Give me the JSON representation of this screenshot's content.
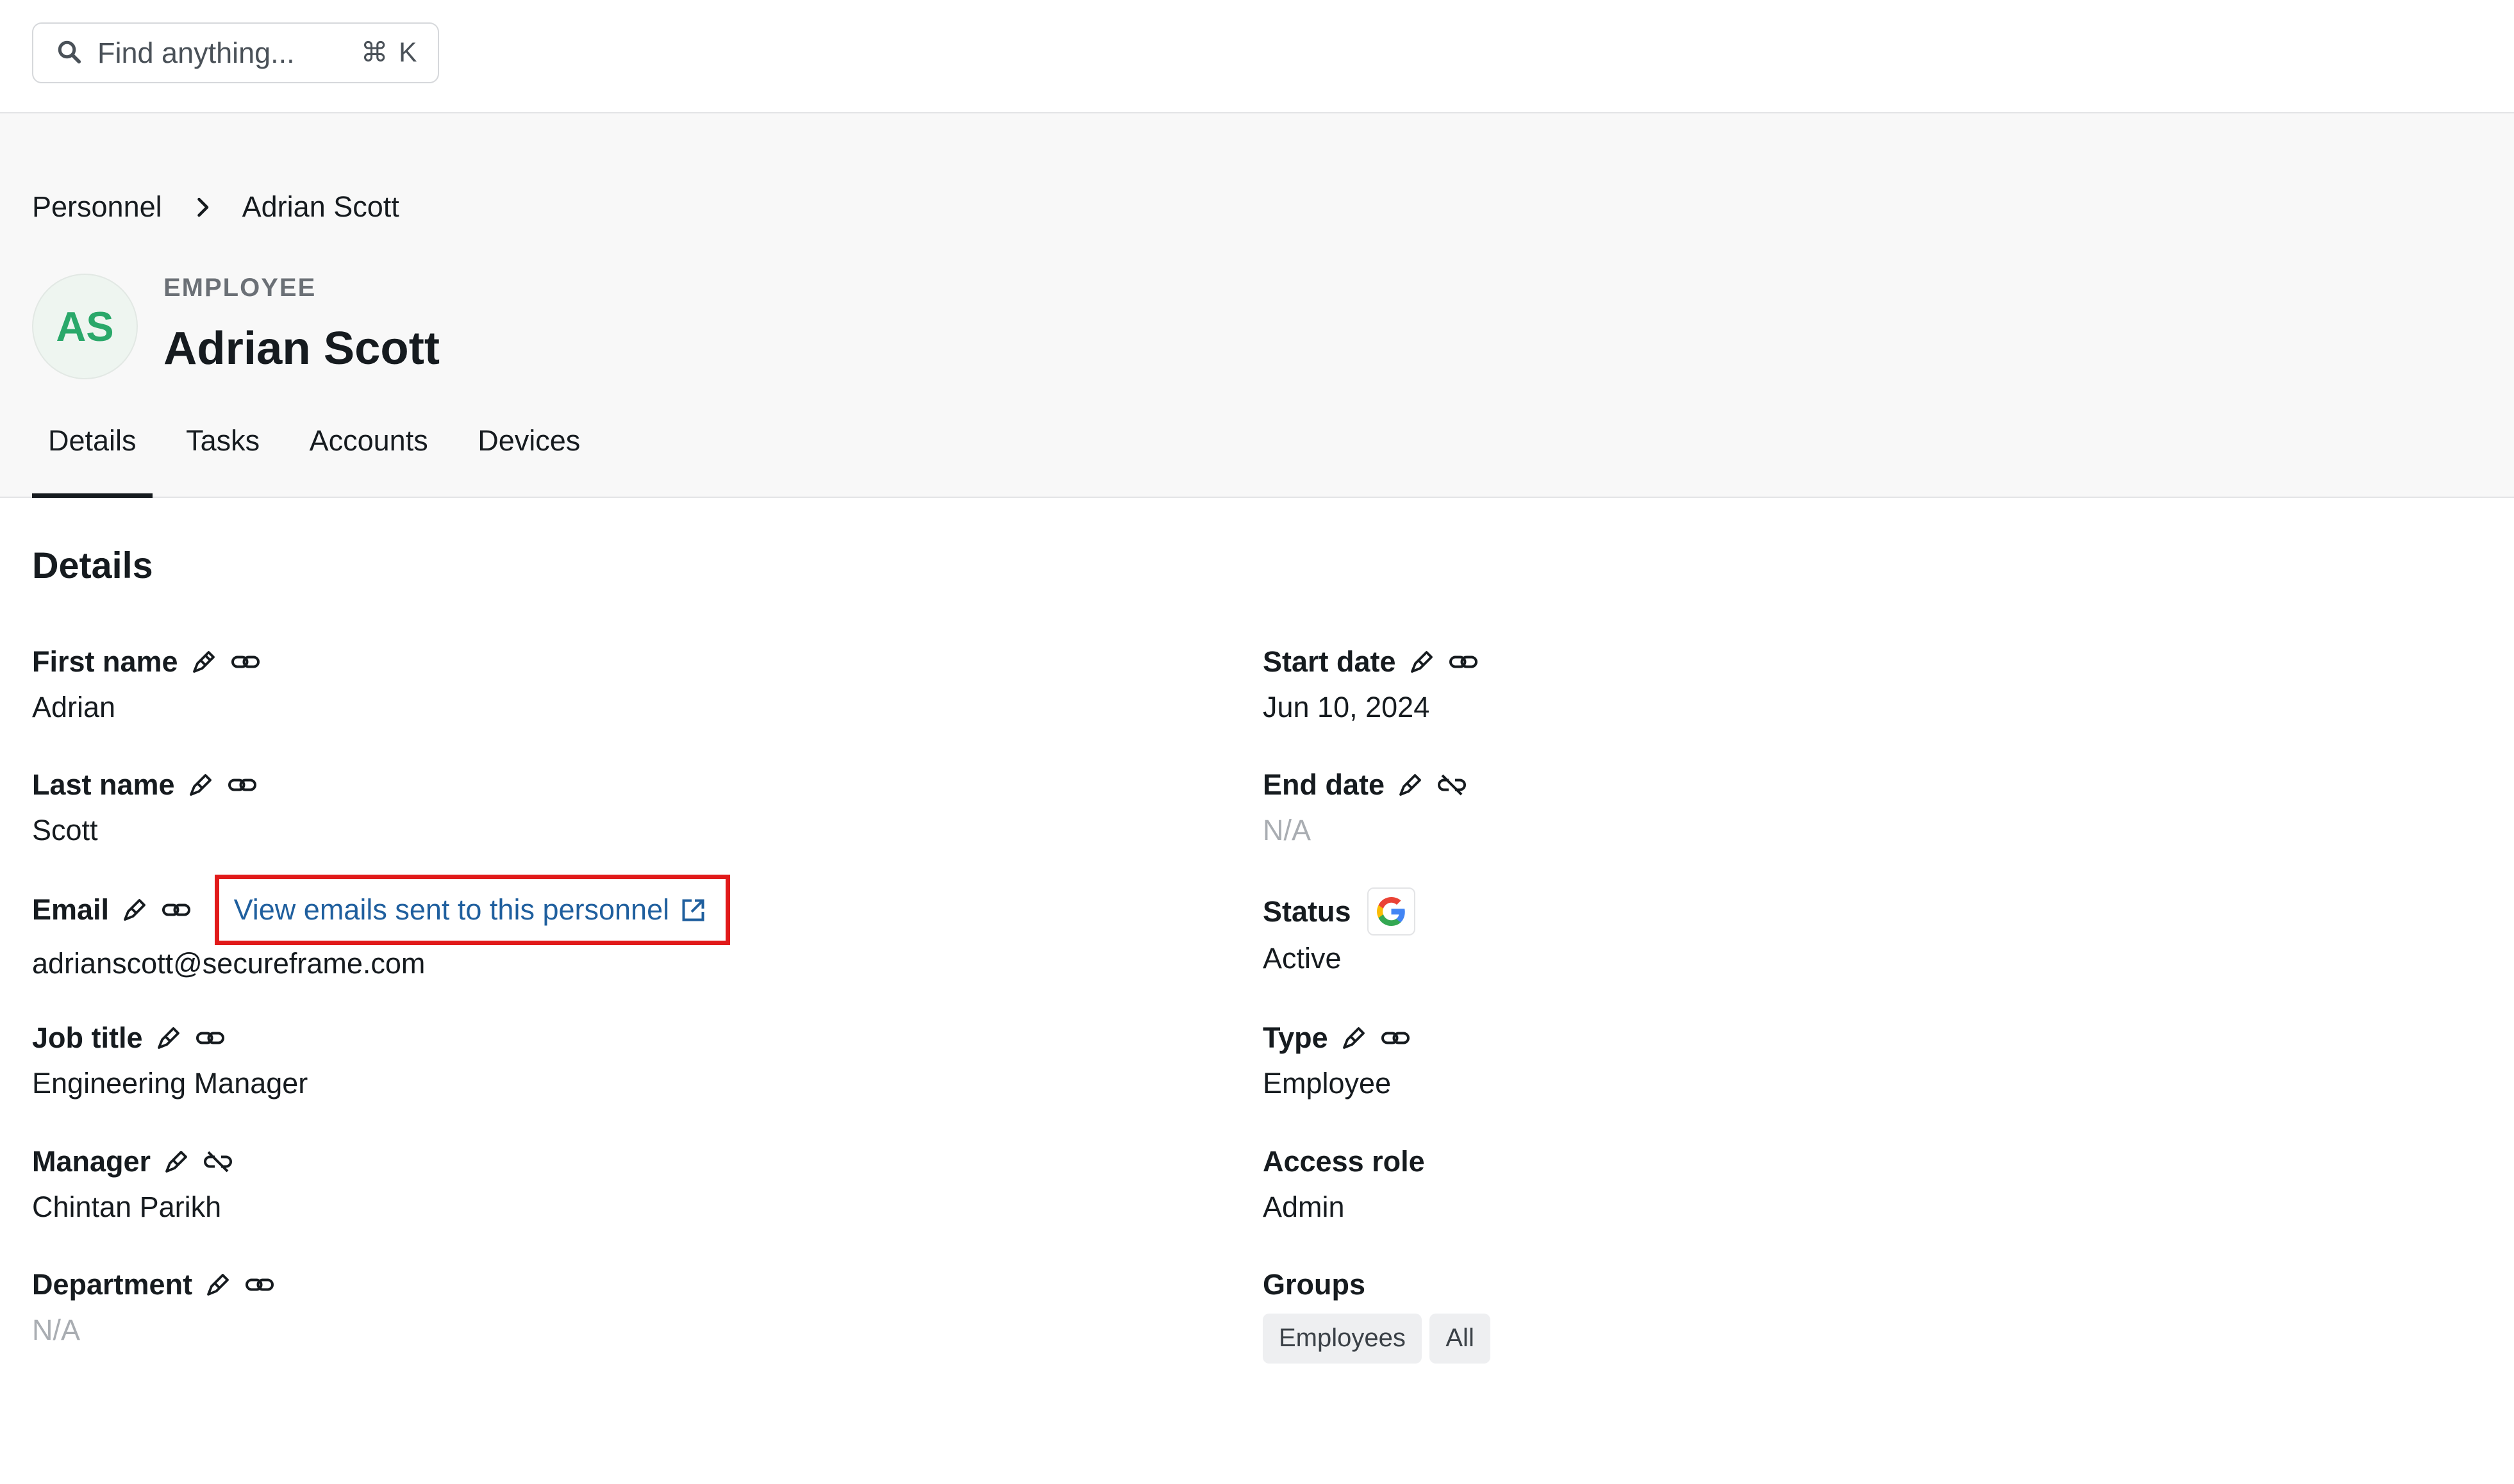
{
  "search": {
    "placeholder": "Find anything...",
    "shortcut": "⌘ K",
    "icon": "search-icon"
  },
  "breadcrumb": {
    "parent": "Personnel",
    "current": "Adrian Scott"
  },
  "profile": {
    "initials": "AS",
    "role": "EMPLOYEE",
    "name": "Adrian Scott"
  },
  "tabs": [
    {
      "label": "Details",
      "active": true
    },
    {
      "label": "Tasks",
      "active": false
    },
    {
      "label": "Accounts",
      "active": false
    },
    {
      "label": "Devices",
      "active": false
    }
  ],
  "details": {
    "title": "Details",
    "left": {
      "first_name": {
        "label": "First name",
        "value": "Adrian"
      },
      "last_name": {
        "label": "Last name",
        "value": "Scott"
      },
      "email": {
        "label": "Email",
        "link": "View emails sent to this personnel",
        "value": "adrianscott@secureframe.com"
      },
      "job_title": {
        "label": "Job title",
        "value": "Engineering Manager"
      },
      "manager": {
        "label": "Manager",
        "value": "Chintan Parikh"
      },
      "department": {
        "label": "Department",
        "value": "N/A"
      }
    },
    "right": {
      "start_date": {
        "label": "Start date",
        "value": "Jun 10, 2024"
      },
      "end_date": {
        "label": "End date",
        "value": "N/A"
      },
      "status": {
        "label": "Status",
        "value": "Active",
        "source_icon": "google-icon"
      },
      "type": {
        "label": "Type",
        "value": "Employee"
      },
      "access_role": {
        "label": "Access role",
        "value": "Admin"
      },
      "groups": {
        "label": "Groups",
        "items": [
          "Employees",
          "All"
        ]
      }
    }
  },
  "colors": {
    "accent_green": "#2aa86a",
    "link_blue": "#1f5f9e",
    "highlight_red": "#e11a1a"
  }
}
